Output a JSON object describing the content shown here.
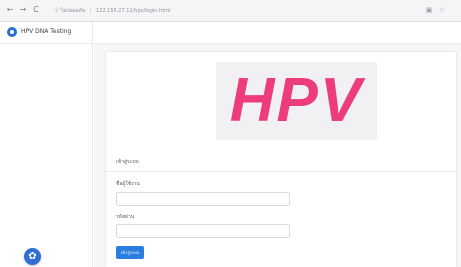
{
  "browser": {
    "back": "←",
    "forward": "→",
    "reload": "C",
    "security": "ⓘ",
    "security_text": "ไม่ปลอดภัย",
    "address": "122.155.27.11/hpv/login.html",
    "translate_icon": "▣",
    "bookmark_icon": "☆"
  },
  "sidebar": {
    "brand_name": "HPV DNA Testing",
    "fab_icon": "✿"
  },
  "login": {
    "logo_text": "HPV",
    "section_title": "เข้าสู่ระบบ",
    "username_label": "ชื่อผู้ใช้งาน",
    "username_value": "",
    "password_label": "รหัสผ่าน",
    "password_value": "",
    "submit_label": "เข้าสู่ระบบ"
  },
  "colors": {
    "accent": "#2f6fd4",
    "logo": "#ec3c7c",
    "button": "#2a7de1"
  }
}
